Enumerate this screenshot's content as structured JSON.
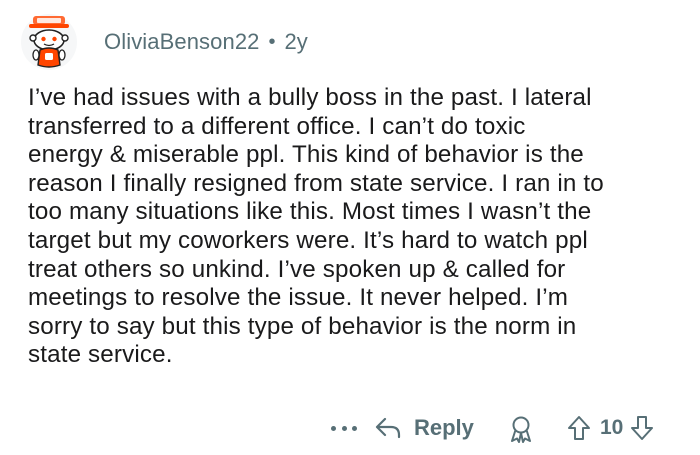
{
  "comment": {
    "username": "OliviaBenson22",
    "separator": "•",
    "age": "2y",
    "body_lines": [
      "I’ve had issues with a bully boss in the past. I lateral",
      "transferred to a different office. I can’t do toxic",
      "energy & miserable ppl. This kind of behavior is the",
      "reason I finally resigned from state service. I ran in to",
      "too many situations like this. Most times I wasn’t the",
      "target but my coworkers were. It’s hard to watch ppl",
      "treat others so unkind. I’ve spoken up & called for",
      "meetings to resolve the issue. It never helped. I’m",
      "sorry to say but this type of behavior is the norm in",
      "state service."
    ]
  },
  "actions": {
    "reply_label": "Reply",
    "vote_count": "10",
    "icons": [
      "more-icon",
      "reply-icon",
      "award-icon",
      "upvote-icon",
      "downvote-icon"
    ]
  },
  "colors": {
    "text": "#1a1a1b",
    "meta": "#576f76",
    "avatar_accent": "#ff4500"
  }
}
